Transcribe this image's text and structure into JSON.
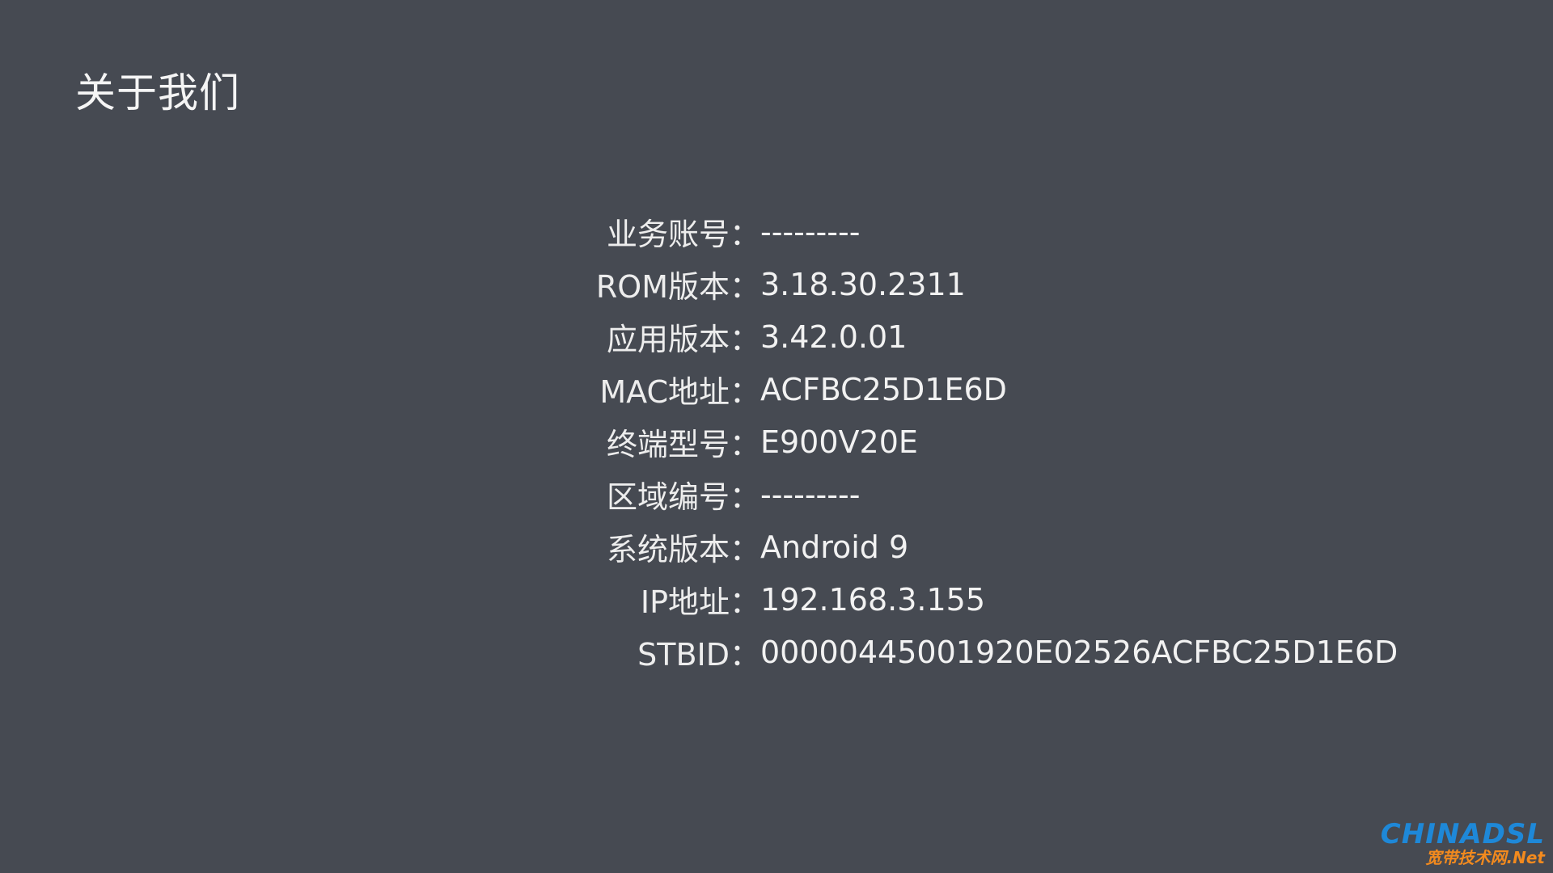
{
  "screen": {
    "title": "关于我们"
  },
  "info": [
    {
      "label": "业务账号：",
      "value": "---------"
    },
    {
      "label": "ROM版本：",
      "value": "3.18.30.2311"
    },
    {
      "label": "应用版本：",
      "value": "3.42.0.01"
    },
    {
      "label": "MAC地址：",
      "value": "ACFBC25D1E6D"
    },
    {
      "label": "终端型号：",
      "value": "E900V20E"
    },
    {
      "label": "区域编号：",
      "value": "---------"
    },
    {
      "label": "系统版本：",
      "value": "Android 9"
    },
    {
      "label": "IP地址：",
      "value": "192.168.3.155"
    },
    {
      "label": "STBID：",
      "value": "00000445001920E02526ACFBC25D1E6D"
    }
  ],
  "watermark": {
    "brand": "CHINADSL",
    "subtitle": "宽带技术网.Net"
  },
  "colors": {
    "background": "#464a52",
    "text": "#f2f2f2",
    "watermark_blue": "#1e88d8",
    "watermark_orange": "#f28a1e"
  }
}
